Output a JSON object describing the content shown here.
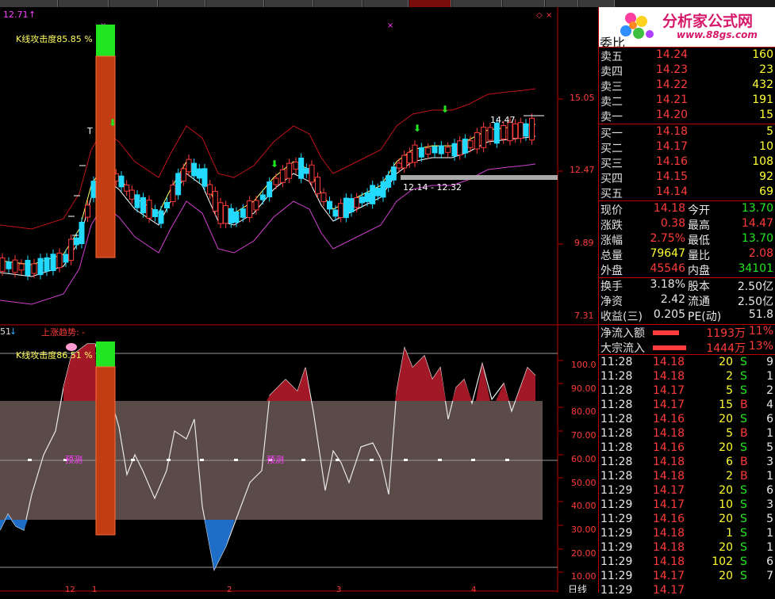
{
  "toolbar": {
    "tabs": 13,
    "active_index": 8
  },
  "main_chart": {
    "price_high_label": "12.71",
    "indicator_label": "K线攻击度85.85 %",
    "price_axis": [
      "15.05",
      "12.47",
      "9.89",
      "7.31"
    ],
    "annot_high": "14.47",
    "annot_range": "12.14 - 12.32",
    "marker_t": "T"
  },
  "sub_chart": {
    "left_label": "51",
    "trend_label": "上涨趋势: -",
    "indicator_label": "K线攻击度86.51 %",
    "predict_label_1": "预测",
    "predict_label_2": "预测",
    "axis": [
      "100.0",
      "90.00",
      "80.00",
      "70.00",
      "60.00",
      "50.00",
      "40.00",
      "30.00",
      "20.00",
      "10.00"
    ]
  },
  "x_axis": {
    "labels": [
      "12",
      "1",
      "2",
      "3",
      "4"
    ],
    "period": "日线"
  },
  "quote": {
    "logo_text": "分析家公式网",
    "logo_url": "www.88gs.com",
    "header_label": "委比",
    "asks": [
      {
        "label": "卖五",
        "price": "14.24",
        "vol": "160"
      },
      {
        "label": "卖四",
        "price": "14.23",
        "vol": "23"
      },
      {
        "label": "卖三",
        "price": "14.22",
        "vol": "432"
      },
      {
        "label": "卖二",
        "price": "14.21",
        "vol": "191"
      },
      {
        "label": "卖一",
        "price": "14.20",
        "vol": "15"
      }
    ],
    "bids": [
      {
        "label": "买一",
        "price": "14.18",
        "vol": "5"
      },
      {
        "label": "买二",
        "price": "14.17",
        "vol": "10"
      },
      {
        "label": "买三",
        "price": "14.16",
        "vol": "108"
      },
      {
        "label": "买四",
        "price": "14.15",
        "vol": "92"
      },
      {
        "label": "买五",
        "price": "14.14",
        "vol": "69"
      }
    ],
    "stats": [
      {
        "l1": "现价",
        "v1": "14.18",
        "l2": "今开",
        "v2": "13.70"
      },
      {
        "l1": "涨跌",
        "v1": "0.38",
        "l2": "最高",
        "v2": "14.47"
      },
      {
        "l1": "涨幅",
        "v1": "2.75%",
        "l2": "最低",
        "v2": "13.70"
      },
      {
        "l1": "总量",
        "v1": "79647",
        "l2": "量比",
        "v2": "2.08"
      },
      {
        "l1": "外盘",
        "v1": "45546",
        "l2": "内盘",
        "v2": "34101"
      }
    ],
    "fin": [
      {
        "l1": "换手",
        "v1": "3.18%",
        "l2": "股本",
        "v2": "2.50亿"
      },
      {
        "l1": "净资",
        "v1": "2.42",
        "l2": "流通",
        "v2": "2.50亿"
      },
      {
        "l1": "收益(三)",
        "v1": "0.205",
        "l2": "PE(动)",
        "v2": "51.8"
      }
    ],
    "flows": [
      {
        "label": "净流入额",
        "amount": "1193万",
        "pct": "11%",
        "bar": 0.55
      },
      {
        "label": "大宗流入",
        "amount": "1444万",
        "pct": "13%",
        "bar": 0.7
      }
    ],
    "ticks": [
      {
        "t": "11:28",
        "p": "14.18",
        "v": "20",
        "s": "S",
        "n": "9"
      },
      {
        "t": "11:28",
        "p": "14.18",
        "v": "2",
        "s": "S",
        "n": "1"
      },
      {
        "t": "11:28",
        "p": "14.17",
        "v": "5",
        "s": "S",
        "n": "2"
      },
      {
        "t": "11:28",
        "p": "14.17",
        "v": "15",
        "s": "B",
        "n": "4"
      },
      {
        "t": "11:28",
        "p": "14.16",
        "v": "20",
        "s": "S",
        "n": "6"
      },
      {
        "t": "11:28",
        "p": "14.18",
        "v": "5",
        "s": "B",
        "n": "1"
      },
      {
        "t": "11:28",
        "p": "14.16",
        "v": "20",
        "s": "S",
        "n": "5"
      },
      {
        "t": "11:28",
        "p": "14.18",
        "v": "6",
        "s": "B",
        "n": "3"
      },
      {
        "t": "11:28",
        "p": "14.18",
        "v": "2",
        "s": "B",
        "n": "1"
      },
      {
        "t": "11:29",
        "p": "14.17",
        "v": "20",
        "s": "S",
        "n": "6"
      },
      {
        "t": "11:29",
        "p": "14.17",
        "v": "10",
        "s": "S",
        "n": "3"
      },
      {
        "t": "11:29",
        "p": "14.16",
        "v": "20",
        "s": "S",
        "n": "5"
      },
      {
        "t": "11:29",
        "p": "14.18",
        "v": "1",
        "s": "S",
        "n": "1"
      },
      {
        "t": "11:29",
        "p": "14.18",
        "v": "20",
        "s": "S",
        "n": "1"
      },
      {
        "t": "11:29",
        "p": "14.18",
        "v": "102",
        "s": "S",
        "n": "6"
      },
      {
        "t": "11:29",
        "p": "14.17",
        "v": "20",
        "s": "S",
        "n": "7"
      },
      {
        "t": "11:29",
        "p": "14.17",
        "v": "",
        "s": "",
        "n": ""
      }
    ]
  }
}
